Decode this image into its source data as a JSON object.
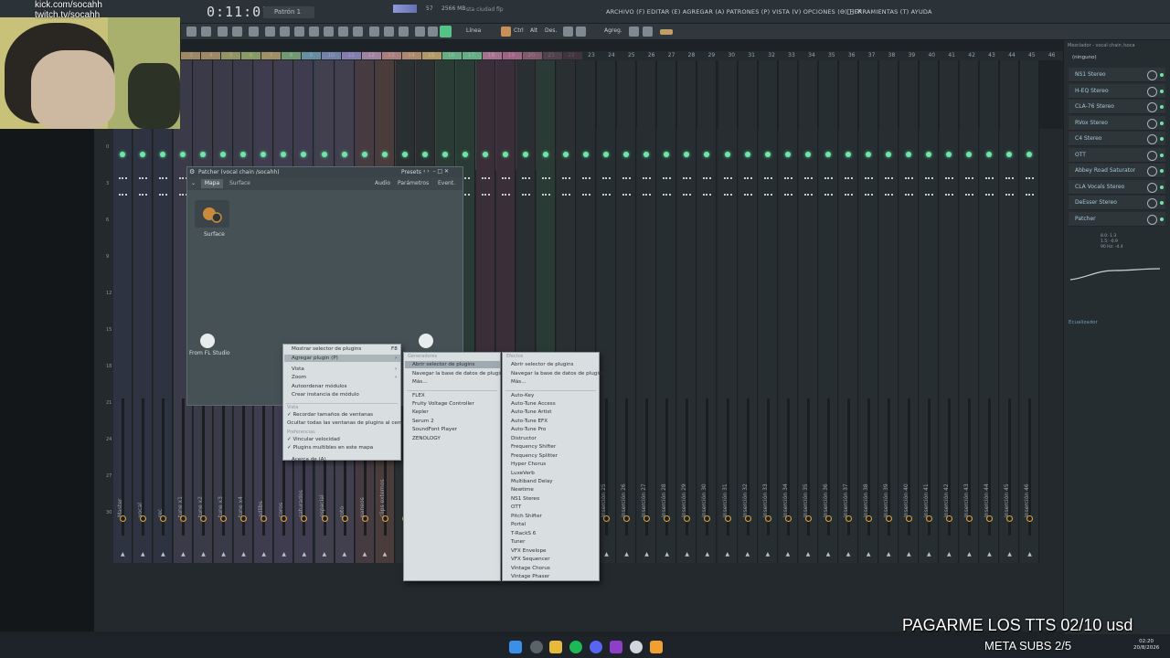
{
  "stream": {
    "kick": "kick.com/socahh",
    "twitch": "twitch.tv/socahh",
    "tts_banner": "PAGARME LOS TTS 02/10 usd",
    "meta_subs": "META SUBS 2/5"
  },
  "transport": {
    "time": "0:11:01",
    "pattern": "Patrón 1",
    "cpu": "57",
    "memory": "2566 MB",
    "song": "sta ciudad flp"
  },
  "menubar": {
    "items": "ARCHIVO (F)  EDITAR (E)  AGREGAR (A)  PATRONES (P)  VISTA (V)  OPCIONES (O)  HERRAMIENTAS (T)  AYUDA",
    "window_controls": "–  □  ✕"
  },
  "toolbar": {
    "mode_label": "Línea",
    "ctrl_label": "Ctrl",
    "alt_label": "Alt",
    "des_label": "Des.",
    "agreg_label": "Agreg."
  },
  "ruler": {
    "numbers": [
      "3",
      "4",
      "5",
      "6",
      "7",
      "8",
      "9",
      "10",
      "11",
      "12",
      "13",
      "14",
      "15",
      "16",
      "17",
      "18",
      "19",
      "20",
      "21",
      "22",
      "23",
      "24",
      "25",
      "26",
      "27",
      "28",
      "29",
      "30",
      "31",
      "32",
      "33",
      "34",
      "35",
      "36",
      "37",
      "38",
      "39",
      "40",
      "41",
      "42",
      "43",
      "44",
      "45",
      "46"
    ]
  },
  "patcher": {
    "title": "Patcher (vocal chain /socahh)",
    "presets_label": "Presets",
    "tab_map": "Mapa",
    "tab_surface": "Surface",
    "audio_label": "Audio",
    "params_label": "Parámetros",
    "events_label": "Event.",
    "surface_node_label": "Surface",
    "from_fl_label": "From FL Studio"
  },
  "menu_main": {
    "items": [
      {
        "label": "Mostrar selector de plugins",
        "shortcut": "F8"
      },
      {
        "label": "Agregar plugin (P)",
        "arrow": "›"
      },
      {
        "label": "Vista",
        "arrow": "›"
      },
      {
        "label": "Zoom",
        "arrow": "›"
      },
      {
        "label": "Autoordenar módulos"
      },
      {
        "label": "Crear instancia de módulo"
      }
    ],
    "header_view": "Vista",
    "view_items": [
      "✓ Recordar tamaños de ventanas",
      "   Ocultar todas las ventanas de plugins al cerrar"
    ],
    "header_options": "Preferencias",
    "option_items": [
      "✓ Vincular velocidad",
      "✓ Plugins multibles en este mapa"
    ],
    "about": "Acerca de (A)"
  },
  "menu_generators": {
    "header": "Generadores",
    "top_items": [
      "Abrir selector de plugins",
      "Navegar la base de datos de plugins",
      "Más..."
    ],
    "items": [
      "FLEX",
      "Fruity Voltage Controller",
      "Kepler",
      "Serum 2",
      "SoundFont Player",
      "ZENOLOGY"
    ]
  },
  "menu_effects": {
    "header": "Efectos",
    "top_items": [
      "Abrir selector de plugins",
      "Navegar la base de datos de plugins",
      "Más..."
    ],
    "items": [
      "Auto-Key",
      "Auto-Tune Access",
      "Auto-Tune Artist",
      "Auto-Tune EFX",
      "Auto-Tune Pro",
      "Distructor",
      "Frequency Shifter",
      "Frequency Splitter",
      "Hyper Chorus",
      "LuxeVerb",
      "Multiband Delay",
      "Newtime",
      "NS1 Stereo",
      "OTT",
      "Pitch Shifter",
      "Portal",
      "T-RackS 6",
      "Tuner",
      "VFX Envelope",
      "VFX Sequencer",
      "Vintage Chorus",
      "Vintage Phaser"
    ]
  },
  "mixer": {
    "title": "Mezclador - vocal chain /soca",
    "none_label": "(ninguno)",
    "slots": [
      "NS1 Stereo",
      "H-EQ Stereo",
      "CLA-76 Stereo",
      "RVox Stereo",
      "C4 Stereo",
      "OTT",
      "Abbey Road Saturator",
      "CLA Vocals Stereo",
      "DeEsser Stereo",
      "Patcher"
    ],
    "eq_label": "Ecualizador",
    "eq_values": [
      "8.0: 1.3",
      "1.5: -0.9",
      "90 Hz: -4.4"
    ],
    "insert_names": [
      "Master",
      "vocal",
      "rec",
      "tune x1",
      "tune x2",
      "tune x3",
      "tune x4",
      "adlibs",
      "coros",
      "saturados",
      "espacial",
      "roto",
      "paneos",
      "clips externos",
      "",
      "",
      "",
      "",
      "",
      "",
      "",
      "",
      "",
      "Inserción 24",
      "Inserción 25",
      "Inserción 26",
      "Inserción 27",
      "Inserción 28",
      "Inserción 29",
      "Inserción 30",
      "Inserción 31",
      "Inserción 32",
      "Inserción 33",
      "Inserción 34",
      "Inserción 35",
      "Inserción 36",
      "Inserción 37",
      "Inserción 38",
      "Inserción 39",
      "Inserción 40",
      "Inserción 41",
      "Inserción 42",
      "Inserción 43",
      "Inserción 44",
      "Inserción 45",
      "Inserción 46"
    ]
  },
  "clock": {
    "time": "02:20",
    "date": "20/8/2026"
  },
  "colors": {
    "accent_green": "#6ee6a8",
    "highlight": "#aab4b9"
  }
}
